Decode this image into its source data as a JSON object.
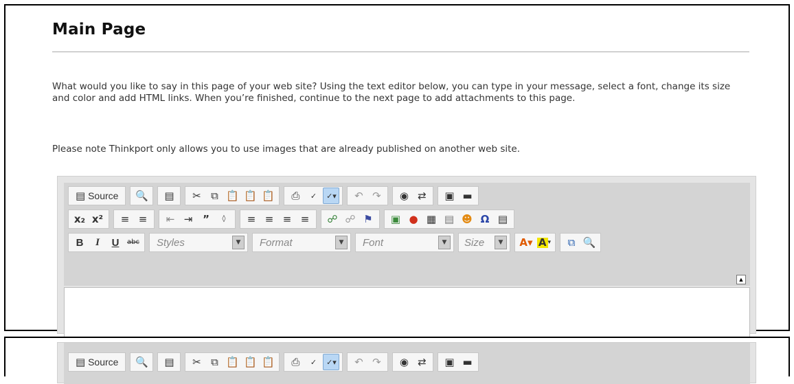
{
  "page": {
    "title": "Main Page",
    "intro": "What would you like to say in this page of your web site? Using the text editor below, you can type in your message, select a font, change its size and color and add HTML links. When you’re finished, continue to the next page to add attachments to this page.",
    "note": "Please note Thinkport only allows you to use images that are already published on another web site."
  },
  "toolbar": {
    "source_label": "Source",
    "styles_label": "Styles",
    "format_label": "Format",
    "font_label": "Font",
    "size_label": "Size"
  },
  "colors": {
    "toolbar_bg": "#d4d4d4",
    "group_bg": "#f6f6f6",
    "active_bg": "#b9d7f4",
    "text_color_icon": "#e05a00",
    "bg_color_icon": "#f2e600"
  }
}
